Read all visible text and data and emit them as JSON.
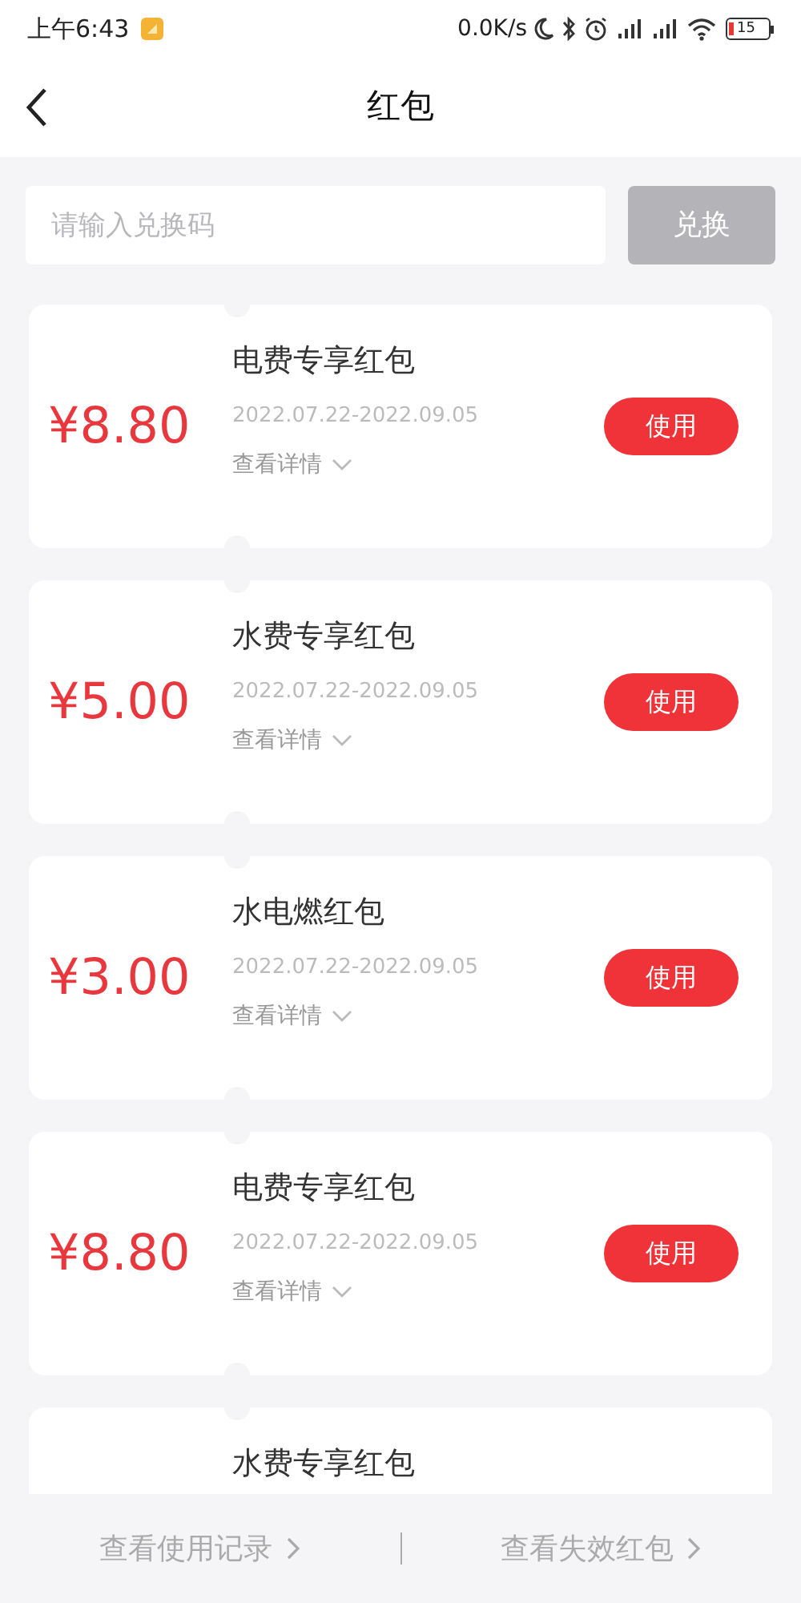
{
  "status_bar": {
    "time": "上午6:43",
    "speed": "0.0K/s",
    "battery": "15"
  },
  "header": {
    "title": "红包"
  },
  "redeem": {
    "placeholder": "请输入兑换码",
    "button": "兑换",
    "disabled": true
  },
  "coupons": [
    {
      "amount": "¥8.80",
      "title": "电费专享红包",
      "validity": "2022.07.22-2022.09.05",
      "details": "查看详情",
      "button": "使用"
    },
    {
      "amount": "¥5.00",
      "title": "水费专享红包",
      "validity": "2022.07.22-2022.09.05",
      "details": "查看详情",
      "button": "使用"
    },
    {
      "amount": "¥3.00",
      "title": "水电燃红包",
      "validity": "2022.07.22-2022.09.05",
      "details": "查看详情",
      "button": "使用"
    },
    {
      "amount": "¥8.80",
      "title": "电费专享红包",
      "validity": "2022.07.22-2022.09.05",
      "details": "查看详情",
      "button": "使用"
    },
    {
      "title": "水费专享红包"
    }
  ],
  "footer": {
    "links": [
      "查看使用记录",
      "查看失效红包"
    ]
  }
}
